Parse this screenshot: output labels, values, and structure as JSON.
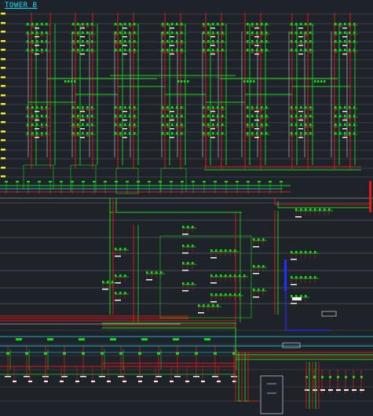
{
  "drawing": {
    "title": "TOWER B"
  },
  "colors": {
    "background": "#1e2229",
    "main_red": "#e01a1a",
    "green": "#18d818",
    "white": "#f2f2f2",
    "yellow": "#f6ea1e",
    "cyan": "#17e0ff",
    "blue": "#2030ff",
    "grey_line": "#c8c8c8",
    "dark_red": "#a01010"
  }
}
